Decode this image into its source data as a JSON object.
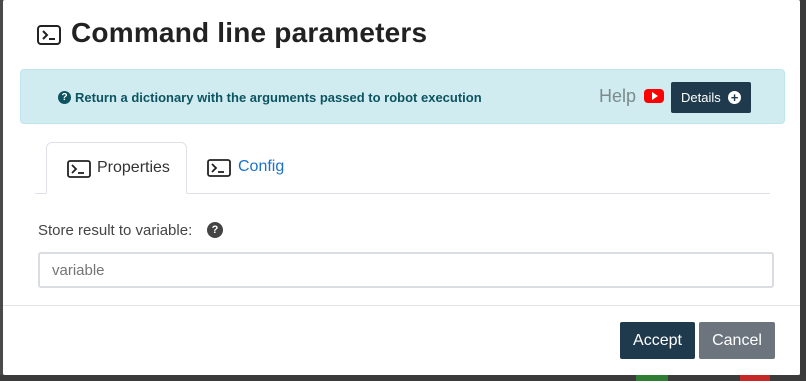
{
  "dialog": {
    "title": "Command line parameters",
    "title_icon": "terminal-icon"
  },
  "help": {
    "description": "Return a dictionary with the arguments passed to robot execution",
    "label": "Help",
    "video_icon": "youtube-icon",
    "details_label": "Details",
    "colors": {
      "background": "#d1ecf1",
      "text": "#0c5460"
    }
  },
  "tabs": [
    {
      "label": "Properties",
      "icon": "terminal-icon",
      "active": true
    },
    {
      "label": "Config",
      "icon": "terminal-icon",
      "active": false
    }
  ],
  "form": {
    "store_label": "Store result to variable:",
    "store_placeholder": "variable",
    "store_value": ""
  },
  "footer": {
    "accept_label": "Accept",
    "cancel_label": "Cancel"
  },
  "colors": {
    "primary": "#1f3a4d",
    "secondary": "#6c757d",
    "link": "#1a73c9",
    "youtube": "#ff0000"
  }
}
